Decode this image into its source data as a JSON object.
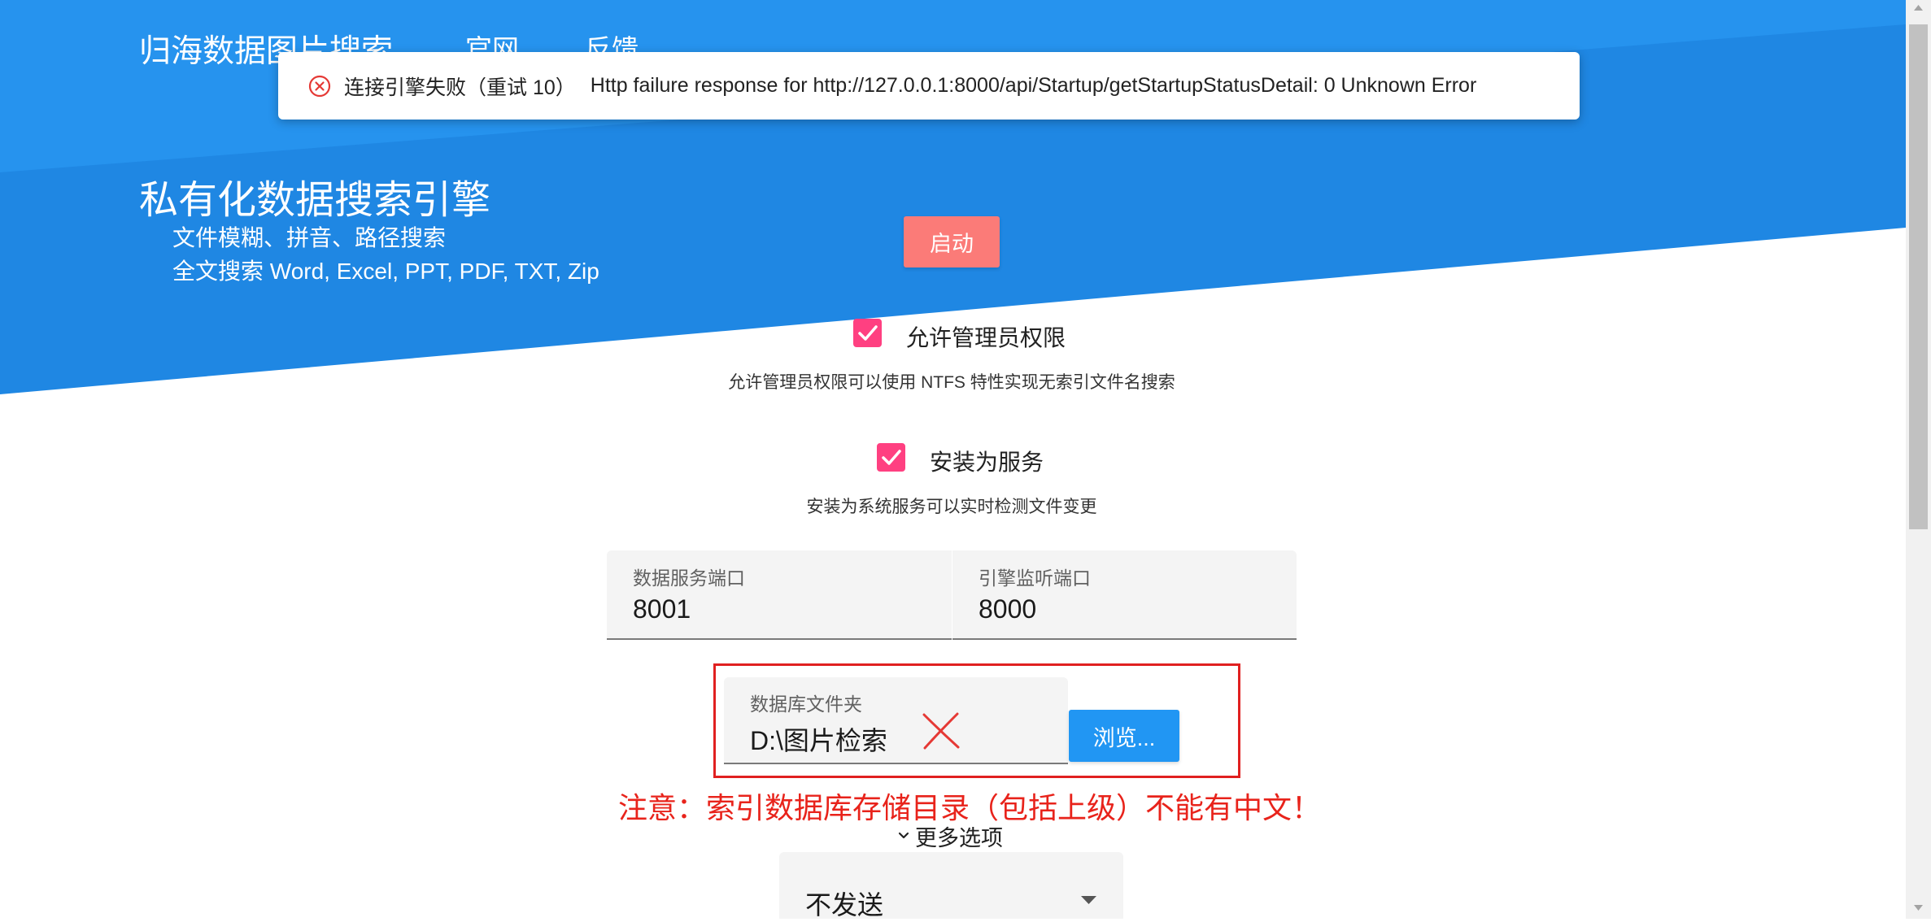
{
  "header": {
    "title": "归海数据图片搜索",
    "nav": [
      {
        "label": "官网"
      },
      {
        "label": "反馈"
      }
    ]
  },
  "toast": {
    "type": "error",
    "icon": "error-circle-icon",
    "title": "连接引擎失败（重试 10）",
    "detail": "Http failure response for http://127.0.0.1:8000/api/Startup/getStartupStatusDetail: 0 Unknown Error"
  },
  "hero": {
    "heading": "私有化数据搜索引擎",
    "features": [
      "文件模糊、拼音、路径搜索",
      "全文搜索 Word, Excel, PPT, PDF, TXT, Zip"
    ]
  },
  "start_button": {
    "label": "启动"
  },
  "options": [
    {
      "label": "允许管理员权限",
      "checked": true,
      "icon": "check-icon",
      "description": "允许管理员权限可以使用 NTFS 特性实现无索引文件名搜索"
    },
    {
      "label": "安装为服务",
      "checked": true,
      "icon": "check-icon",
      "description": "安装为系统服务可以实时检测文件变更"
    }
  ],
  "ports": {
    "data_service": {
      "label": "数据服务端口",
      "value": "8001"
    },
    "engine_listen": {
      "label": "引擎监听端口",
      "value": "8000"
    }
  },
  "database": {
    "label": "数据库文件夹",
    "value": "D:\\图片检索",
    "browse_label": "浏览...",
    "annotation_icon": "red-x-mark-icon"
  },
  "warning": "注意：索引数据库存储目录（包括上级）不能有中文！",
  "more_options": {
    "label": "更多选项",
    "icon": "chevron-down-icon"
  },
  "select": {
    "value": "不发送",
    "icon": "dropdown-arrow-icon"
  },
  "colors": {
    "header": "#1f87e3",
    "primary": "#2196f3",
    "start_button": "#fb7b78",
    "checkbox": "#ff4081",
    "warning": "#e8231b"
  }
}
